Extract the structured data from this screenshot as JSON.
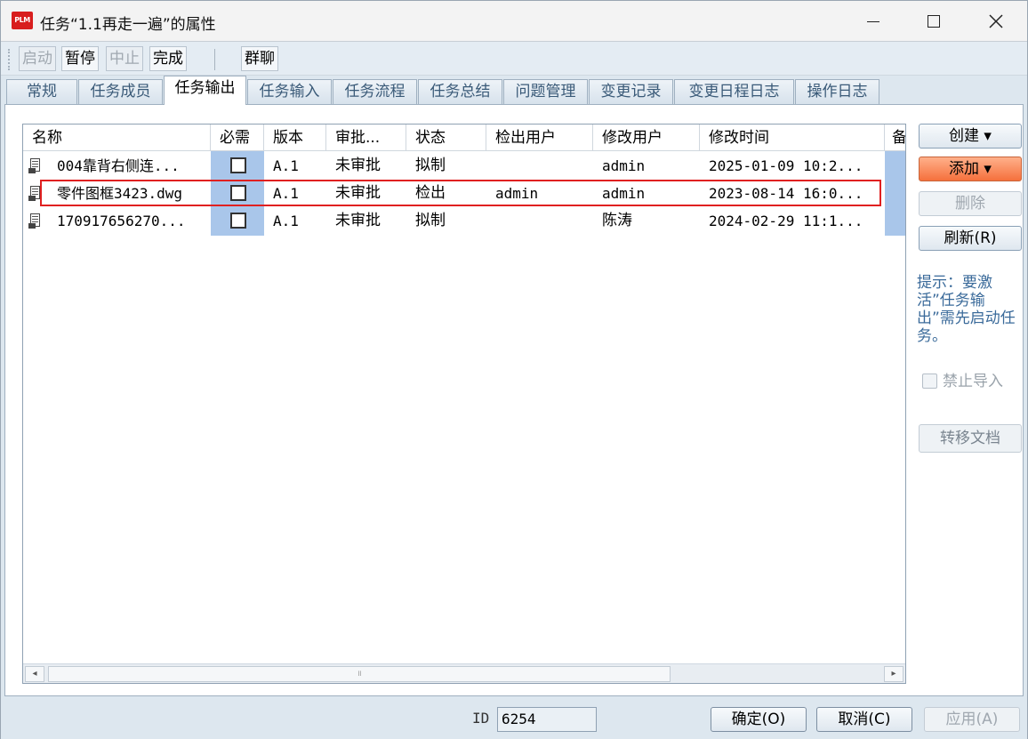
{
  "window": {
    "app_icon_text": "PLM",
    "title": "任务“1.1再走一遍”的属性"
  },
  "toolbar": {
    "start": "启动",
    "pause": "暂停",
    "stop": "中止",
    "complete": "完成",
    "group_chat": "群聊"
  },
  "tabs": [
    {
      "label": "常规"
    },
    {
      "label": "任务成员"
    },
    {
      "label": "任务输出"
    },
    {
      "label": "任务输入"
    },
    {
      "label": "任务流程"
    },
    {
      "label": "任务总结"
    },
    {
      "label": "问题管理"
    },
    {
      "label": "变更记录"
    },
    {
      "label": "变更日程日志"
    },
    {
      "label": "操作日志"
    }
  ],
  "active_tab": "任务输出",
  "grid": {
    "columns": [
      "名称",
      "必需",
      "版本",
      "审批...",
      "状态",
      "检出用户",
      "修改用户",
      "修改时间",
      "备"
    ],
    "rows": [
      {
        "name": "004靠背右侧连...",
        "required": false,
        "version": "A.1",
        "approval": "未审批",
        "status": "拟制",
        "checkout_user": "",
        "modify_user": "admin",
        "modify_time": "2025-01-09 10:2..."
      },
      {
        "name": "零件图框3423.dwg",
        "required": false,
        "version": "A.1",
        "approval": "未审批",
        "status": "检出",
        "checkout_user": "admin",
        "modify_user": "admin",
        "modify_time": "2023-08-14 16:0..."
      },
      {
        "name": "170917656270...",
        "required": false,
        "version": "A.1",
        "approval": "未审批",
        "status": "拟制",
        "checkout_user": "",
        "modify_user": "陈涛",
        "modify_time": "2024-02-29 11:1..."
      }
    ],
    "scroll_thumb_glyph": "॥"
  },
  "side": {
    "create": "创建 ▾",
    "add": "添加 ▾",
    "delete": "删除",
    "refresh": "刷新(R)",
    "hint": "提示：要激活”任务输出”需先启动任务。",
    "ban_import": "禁止导入",
    "transfer": "转移文档"
  },
  "footer": {
    "id_label": "ID",
    "id_value": "6254",
    "ok": "确定(O)",
    "cancel": "取消(C)",
    "apply": "应用(A)"
  },
  "colors": {
    "highlight": "#e02020",
    "add_button": "#f5703c",
    "required_column": "#a9c6ea"
  }
}
